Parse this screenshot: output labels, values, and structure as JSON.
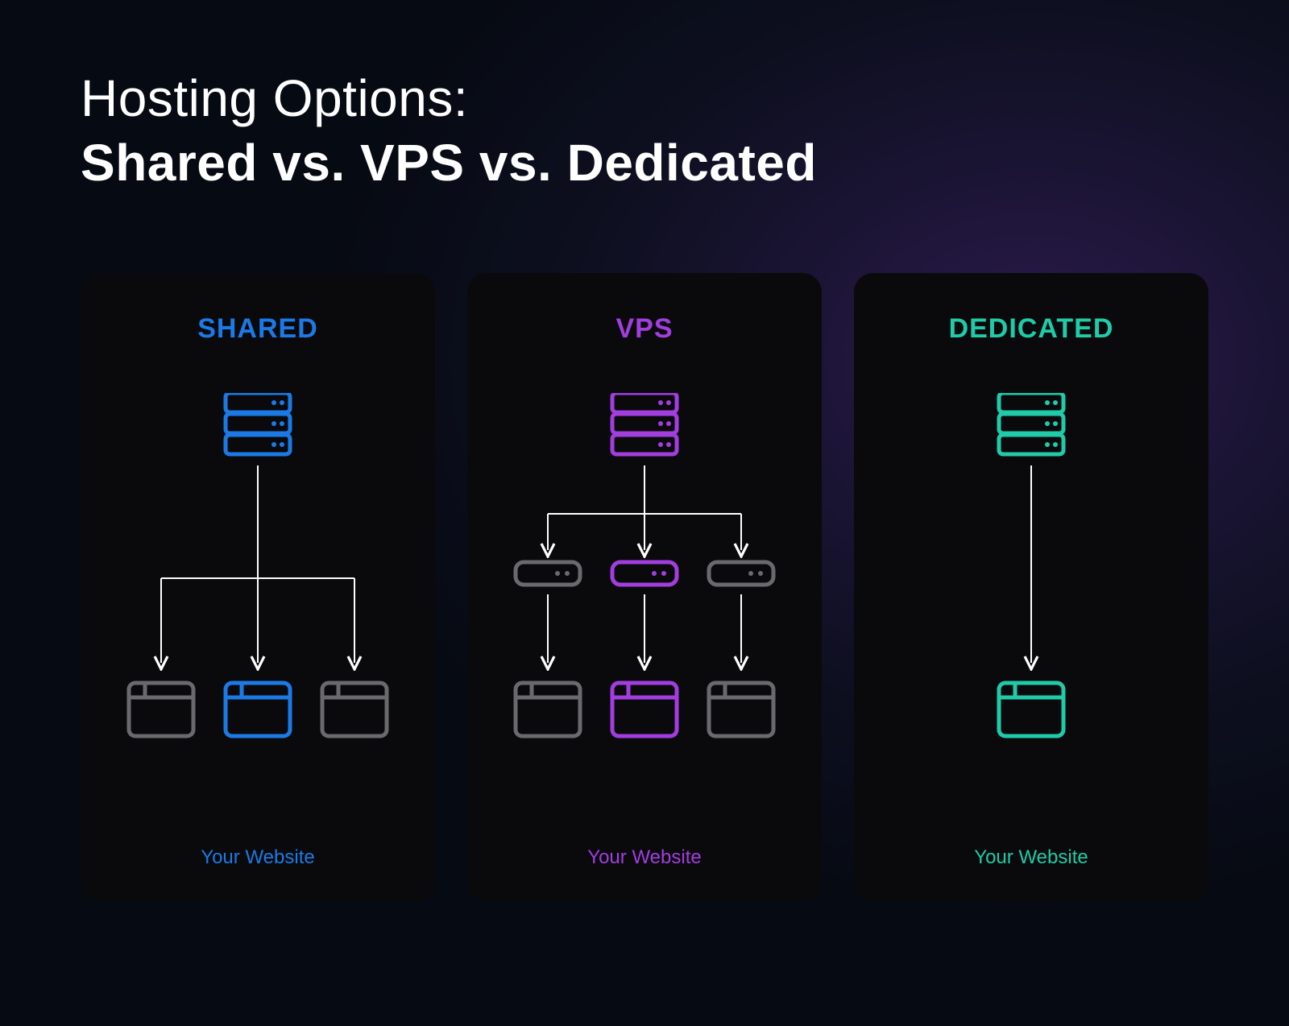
{
  "title": {
    "line1": "Hosting Options:",
    "line2": "Shared vs. VPS vs. Dedicated"
  },
  "cards": [
    {
      "id": "shared",
      "heading": "SHARED",
      "caption": "Your Website",
      "accent_color": "#1b7ae6",
      "gray_color": "#6a6a6e",
      "structure": "One server → three websites (middle highlighted)"
    },
    {
      "id": "vps",
      "heading": "VPS",
      "caption": "Your Website",
      "accent_color": "#a23de0",
      "gray_color": "#6a6a6e",
      "structure": "One server → three virtual servers (middle highlighted) → three websites (middle highlighted)"
    },
    {
      "id": "dedicated",
      "heading": "DEDICATED",
      "caption": "Your Website",
      "accent_color": "#1fcba8",
      "structure": "One server → one website"
    }
  ]
}
